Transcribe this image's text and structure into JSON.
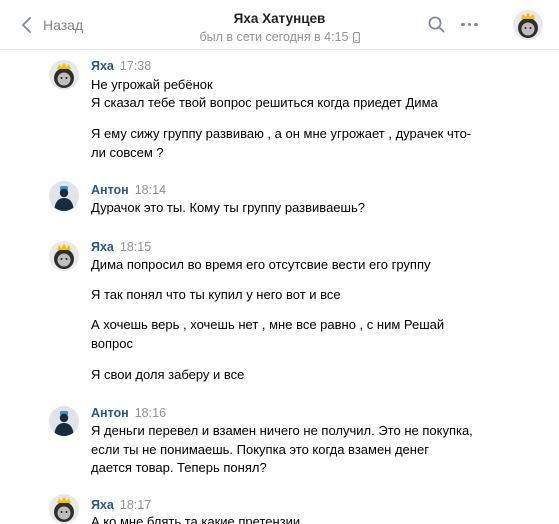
{
  "header": {
    "back_label": "Назад",
    "title": "Яха Хатунцев",
    "status": "был в сети сегодня в 4:15"
  },
  "icons": {
    "back": "chevron-left-icon",
    "mobile": "phone-icon",
    "search": "search-icon",
    "more": "more-dots-icon"
  },
  "colors": {
    "author_name": "#2a5885",
    "timestamp": "#939393",
    "divider": "#e7e8ec"
  },
  "messages": [
    {
      "author": "Яха",
      "time": "17:38",
      "lines": [
        "Не угрожай ребёнок",
        "Я сказал тебе твой вопрос решиться когда приедет Дима",
        "Я ему сижу группу развиваю , а он мне угрожает , дурачек что-",
        "ли совсем ?"
      ]
    },
    {
      "author": "Антон",
      "time": "18:14",
      "lines": [
        "Дурачок это ты. Кому ты группу развиваешь?"
      ]
    },
    {
      "author": "Яха",
      "time": "18:15",
      "lines": [
        "Дима попросил во время его отсутсвие вести его группу",
        "Я так понял что ты купил у него вот и все",
        "А хочешь верь , хочешь нет , мне все равно , с ним Решай",
        "вопрос",
        "Я свои доля заберу и все"
      ]
    },
    {
      "author": "Антон",
      "time": "18:16",
      "lines": [
        "Я деньги перевел и взамен ничего не получил. Это не покупка,",
        "если ты не понимаешь. Покупка это когда взамен денег",
        "дается товар. Теперь понял?"
      ]
    },
    {
      "author": "Яха",
      "time": "18:17",
      "lines": [
        "А ко мне блять та какие претензии"
      ]
    }
  ]
}
